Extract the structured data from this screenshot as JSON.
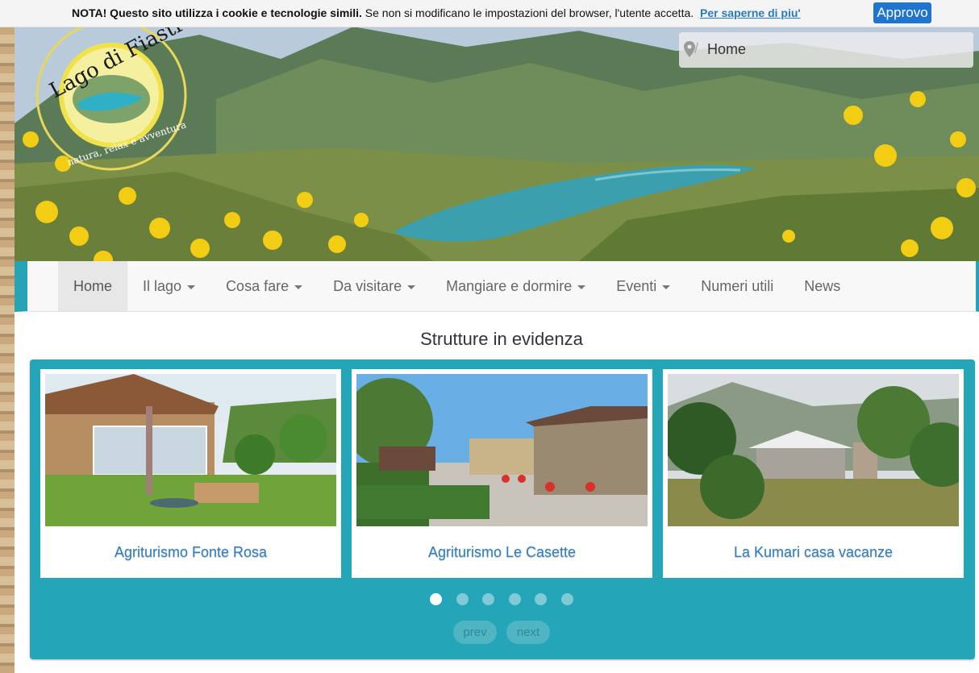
{
  "cookie_bar": {
    "bold_text": "NOTA! Questo sito utilizza i cookie e tecnologie simili.",
    "text": " Se non si modificano le impostazioni del browser, l'utente accetta.",
    "link": "Per saperne di piu'",
    "button": "Approvo"
  },
  "header": {
    "logo_title": "Lago di Fiastra",
    "logo_tagline": "natura, relax e avventura",
    "breadcrumb": "Home"
  },
  "nav": {
    "items": [
      {
        "label": "Home",
        "active": true,
        "dropdown": false
      },
      {
        "label": "Il lago",
        "dropdown": true
      },
      {
        "label": "Cosa fare",
        "dropdown": true
      },
      {
        "label": "Da visitare",
        "dropdown": true
      },
      {
        "label": "Mangiare e dormire",
        "dropdown": true
      },
      {
        "label": "Eventi",
        "dropdown": true
      },
      {
        "label": "Numeri utili",
        "dropdown": false
      },
      {
        "label": "News",
        "dropdown": false
      }
    ]
  },
  "featured": {
    "title": "Strutture in evidenza",
    "cards": [
      {
        "caption": "Agriturismo Fonte Rosa"
      },
      {
        "caption": "Agriturismo Le Casette"
      },
      {
        "caption": "La Kumari casa vacanze"
      }
    ],
    "dots_total": 6,
    "dots_active": 1,
    "prev": "prev",
    "next": "next"
  },
  "colors": {
    "accent": "#24a6b8",
    "link": "#2f7fbf",
    "button": "#1f74cf"
  }
}
